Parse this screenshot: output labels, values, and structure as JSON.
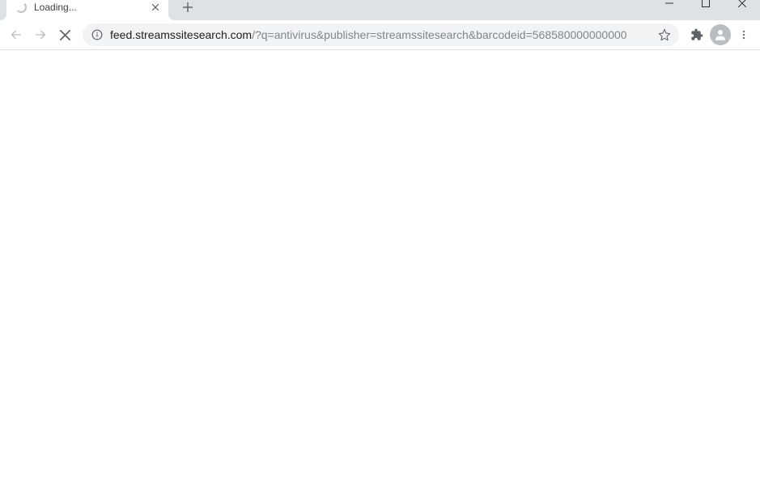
{
  "tab": {
    "title": "Loading..."
  },
  "addressbar": {
    "url_host": "feed.streamssitesearch.com",
    "url_path": "/?q=antivirus&publisher=streamssitesearch&barcodeid=568580000000000"
  }
}
